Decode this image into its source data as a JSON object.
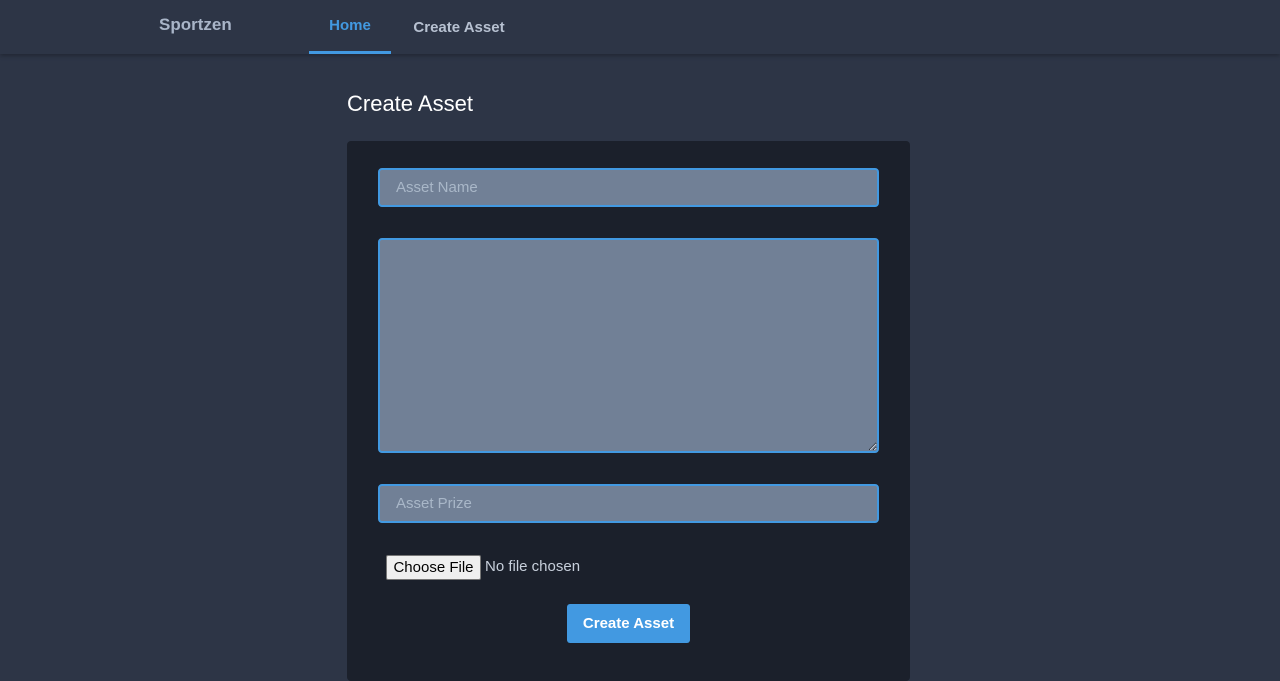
{
  "navbar": {
    "brand": "Sportzen",
    "items": [
      {
        "label": "Home",
        "active": true
      },
      {
        "label": "Create Asset",
        "active": false
      }
    ]
  },
  "page": {
    "title": "Create Asset"
  },
  "form": {
    "asset_name": {
      "value": "",
      "placeholder": "Asset Name"
    },
    "description": {
      "value": "",
      "placeholder": ""
    },
    "asset_prize": {
      "value": "",
      "placeholder": "Asset Prize"
    },
    "file": {
      "button_label": "Choose File",
      "status": "No file chosen"
    },
    "submit_label": "Create Asset"
  },
  "colors": {
    "background": "#2d3546",
    "card": "#1b202b",
    "accent": "#4299e1",
    "input_fill": "#718096"
  }
}
